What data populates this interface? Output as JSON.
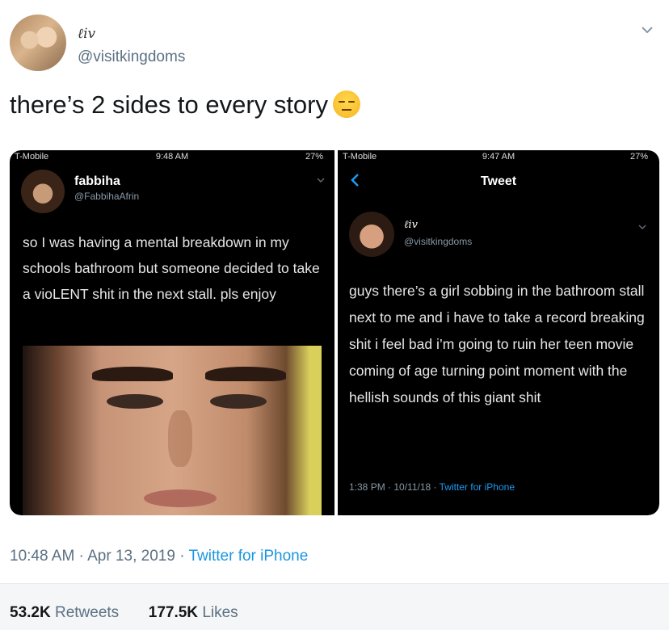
{
  "tweet": {
    "display_name": "ℓiv",
    "handle": "@visitkingdoms",
    "text": "there’s 2 sides to every story",
    "emoji": "pensive-face",
    "timestamp": "10:48 AM · Apr 13, 2019 · ",
    "source": "Twitter for iPhone",
    "retweets_count": "53.2K",
    "retweets_label": "Retweets",
    "likes_count": "177.5K",
    "likes_label": "Likes"
  },
  "left_screenshot": {
    "status_carrier": "T-Mobile",
    "status_time": "9:48 AM",
    "status_battery": "27%",
    "name": "fabbiha",
    "handle": "@FabbihaAfrin",
    "text": "so I was having a mental breakdown in my schools bathroom but someone decided to take a vioLENT shit in the next stall. pls enjoy"
  },
  "right_screenshot": {
    "status_carrier": "T-Mobile",
    "status_time": "9:47 AM",
    "status_battery": "27%",
    "header_title": "Tweet",
    "name": "ℓiv",
    "handle": "@visitkingdoms",
    "text": "guys there’s a girl sobbing in the bathroom stall next to me and i have to take a record breaking shit i feel bad i’m going to ruin her teen movie coming of age turning point moment with the hellish sounds of this giant shit",
    "meta": "1:38 PM · 10/11/18 · ",
    "source": "Twitter for iPhone"
  },
  "colors": {
    "link_blue": "#1b95e0",
    "muted_gray": "#5b7083",
    "dark_bg": "#000000"
  }
}
